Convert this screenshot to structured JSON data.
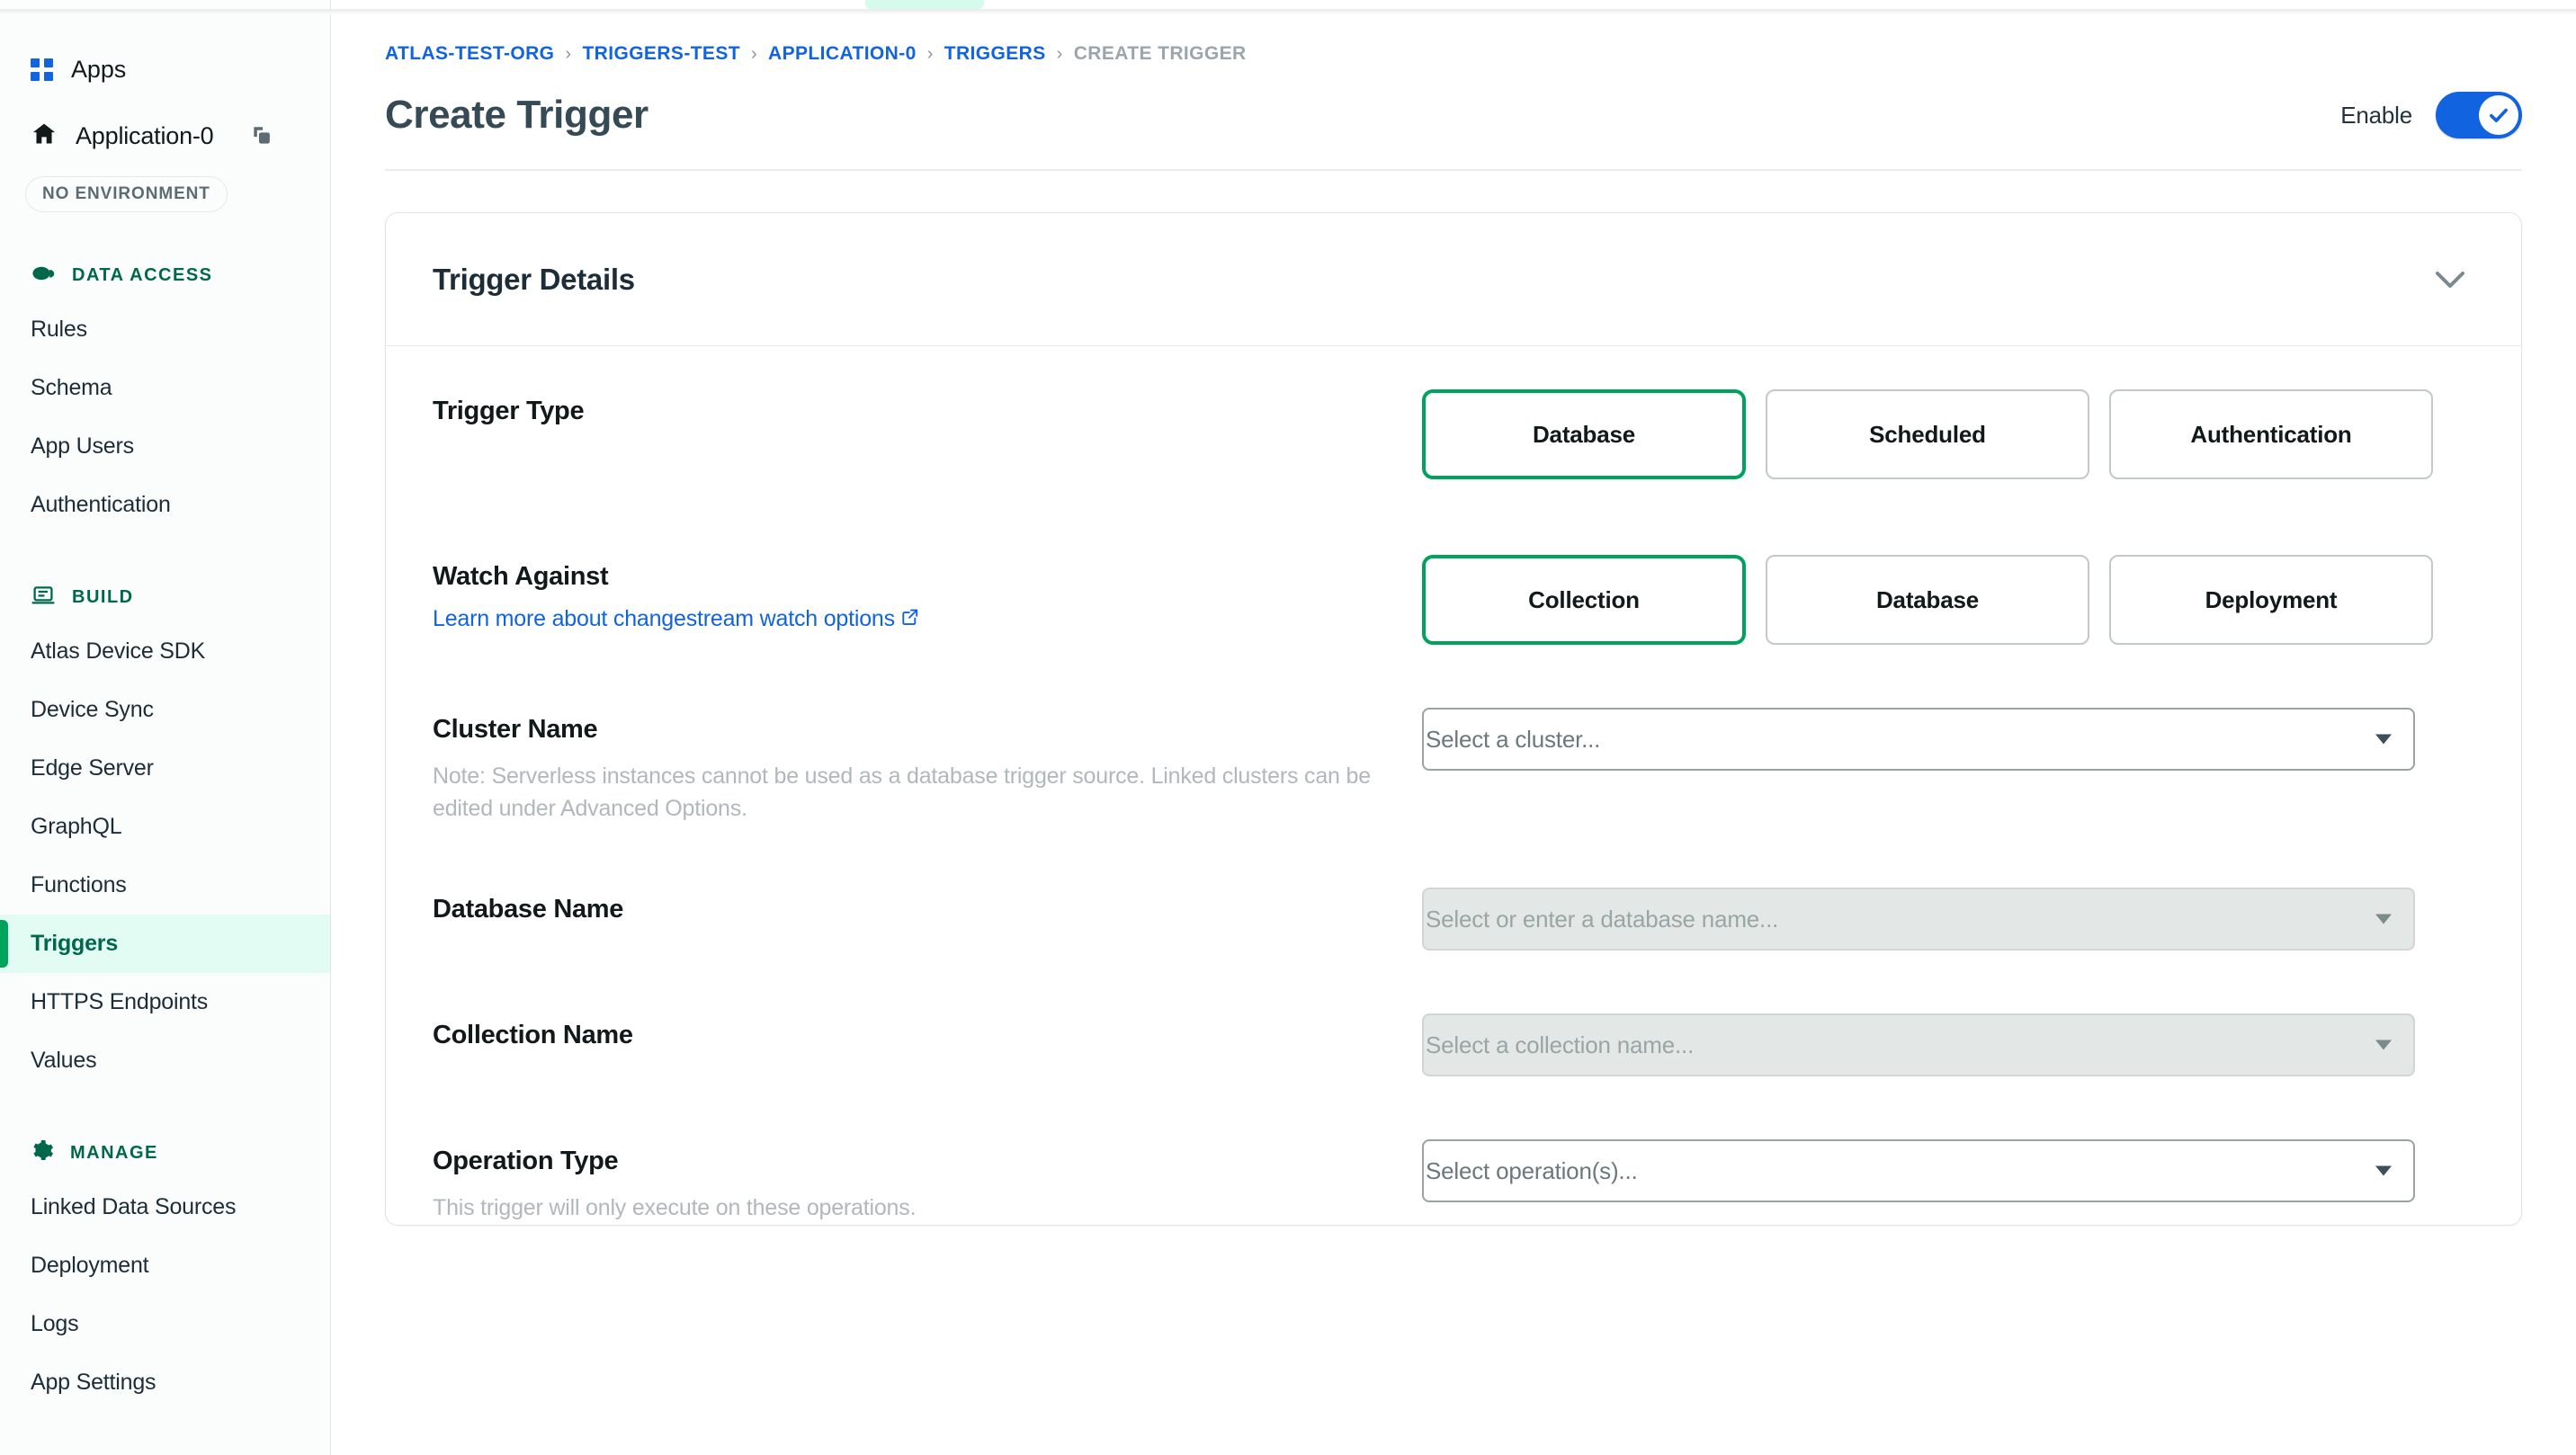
{
  "sidebar": {
    "apps_label": "Apps",
    "app_name": "Application-0",
    "environment_badge": "NO ENVIRONMENT",
    "groups": [
      {
        "title": "DATA ACCESS",
        "icon": "cloud-icon",
        "items": [
          "Rules",
          "Schema",
          "App Users",
          "Authentication"
        ]
      },
      {
        "title": "BUILD",
        "icon": "laptop-icon",
        "items": [
          "Atlas Device SDK",
          "Device Sync",
          "Edge Server",
          "GraphQL",
          "Functions",
          "Triggers",
          "HTTPS Endpoints",
          "Values"
        ]
      },
      {
        "title": "MANAGE",
        "icon": "gear-icon",
        "items": [
          "Linked Data Sources",
          "Deployment",
          "Logs",
          "App Settings"
        ]
      }
    ],
    "active_item": "Triggers"
  },
  "breadcrumb": {
    "items": [
      {
        "label": "ATLAS-TEST-ORG",
        "current": false
      },
      {
        "label": "TRIGGERS-TEST",
        "current": false
      },
      {
        "label": "APPLICATION-0",
        "current": false
      },
      {
        "label": "TRIGGERS",
        "current": false
      },
      {
        "label": "CREATE TRIGGER",
        "current": true
      }
    ],
    "separator": "›"
  },
  "header": {
    "title": "Create Trigger",
    "enable_label": "Enable",
    "enable_state": "on"
  },
  "card": {
    "title": "Trigger Details",
    "collapse_icon": "chevron-down-icon"
  },
  "fields": {
    "trigger_type": {
      "label": "Trigger Type",
      "options": [
        "Database",
        "Scheduled",
        "Authentication"
      ],
      "selected": "Database"
    },
    "watch_against": {
      "label": "Watch Against",
      "link_text": "Learn more about changestream watch options",
      "link_icon": "external-link-icon",
      "options": [
        "Collection",
        "Database",
        "Deployment"
      ],
      "selected": "Collection"
    },
    "cluster_name": {
      "label": "Cluster Name",
      "note": "Note: Serverless instances cannot be used as a database trigger source. Linked clusters can be edited under Advanced Options.",
      "placeholder": "Select a cluster...",
      "value": "",
      "disabled": false
    },
    "database_name": {
      "label": "Database Name",
      "placeholder": "Select or enter a database name...",
      "value": "",
      "disabled": true
    },
    "collection_name": {
      "label": "Collection Name",
      "placeholder": "Select a collection name...",
      "value": "",
      "disabled": true
    },
    "operation_type": {
      "label": "Operation Type",
      "note": "This trigger will only execute on these operations.",
      "placeholder": "Select operation(s)...",
      "value": "",
      "disabled": false
    }
  },
  "colors": {
    "brand_green": "#00684a",
    "accent_green": "#00a35c",
    "link_blue": "#1263e0",
    "active_bg": "#e3fcf3",
    "muted": "#b0b8bc"
  }
}
